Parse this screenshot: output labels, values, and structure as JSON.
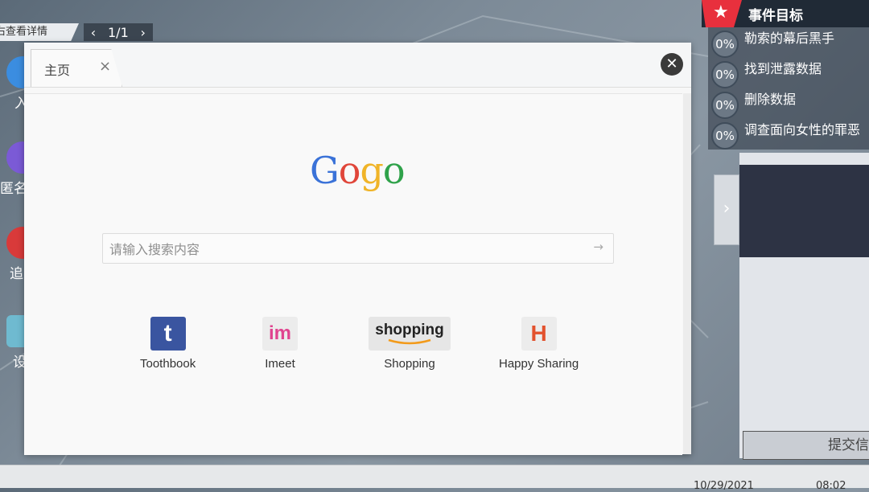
{
  "page_bar": {
    "hint": "右查看详情",
    "prev": "‹",
    "page": "1/1",
    "next": "›"
  },
  "desktop_icons": [
    {
      "label": "入",
      "color": "#3b8de0"
    },
    {
      "label": "匿名",
      "color": "#7b5ad6"
    },
    {
      "label": "追",
      "color": "#d93a3a"
    },
    {
      "label": "设",
      "color": "#6fbad0"
    }
  ],
  "browser": {
    "tab_title": "主页",
    "tab_close": "×",
    "close_button": "✕",
    "logo_letters": [
      {
        "ch": "G",
        "color": "#3a72d8"
      },
      {
        "ch": "o",
        "color": "#e0463a"
      },
      {
        "ch": "g",
        "color": "#f0b428"
      },
      {
        "ch": "o",
        "color": "#2fa24a"
      }
    ],
    "search_placeholder": "请输入搜索内容",
    "search_arrow": "→",
    "shortcuts": [
      {
        "name": "Toothbook",
        "icon": "t",
        "icon_name": "toothbook-icon",
        "bg": "#3a55a0",
        "fg": "#ffffff"
      },
      {
        "name": "Imeet",
        "icon": "im",
        "icon_name": "imeet-icon",
        "bg": "#ececec",
        "fg": "#e0448f"
      },
      {
        "name": "Shopping",
        "icon": "shopping",
        "icon_name": "shopping-icon",
        "bg": "#e6e6e6",
        "fg": "#222222"
      },
      {
        "name": "Happy Sharing",
        "icon": "H",
        "icon_name": "happy-sharing-icon",
        "bg": "#ececec",
        "fg": "#e2522e"
      }
    ]
  },
  "objectives": {
    "title": "事件目标",
    "items": [
      {
        "pct": "0%",
        "text": "勒索的幕后黑手"
      },
      {
        "pct": "0%",
        "text": "找到泄露数据"
      },
      {
        "pct": "0%",
        "text": "删除数据"
      },
      {
        "pct": "0%",
        "text": "调查面向女性的罪恶"
      }
    ]
  },
  "side_panel": {
    "toggle": "›",
    "submit": "提交信"
  },
  "taskbar": {
    "date": "10/29/2021",
    "time": "08:02"
  },
  "colors": {
    "accent_red": "#e8303d",
    "panel_dark": "#2d3344"
  }
}
